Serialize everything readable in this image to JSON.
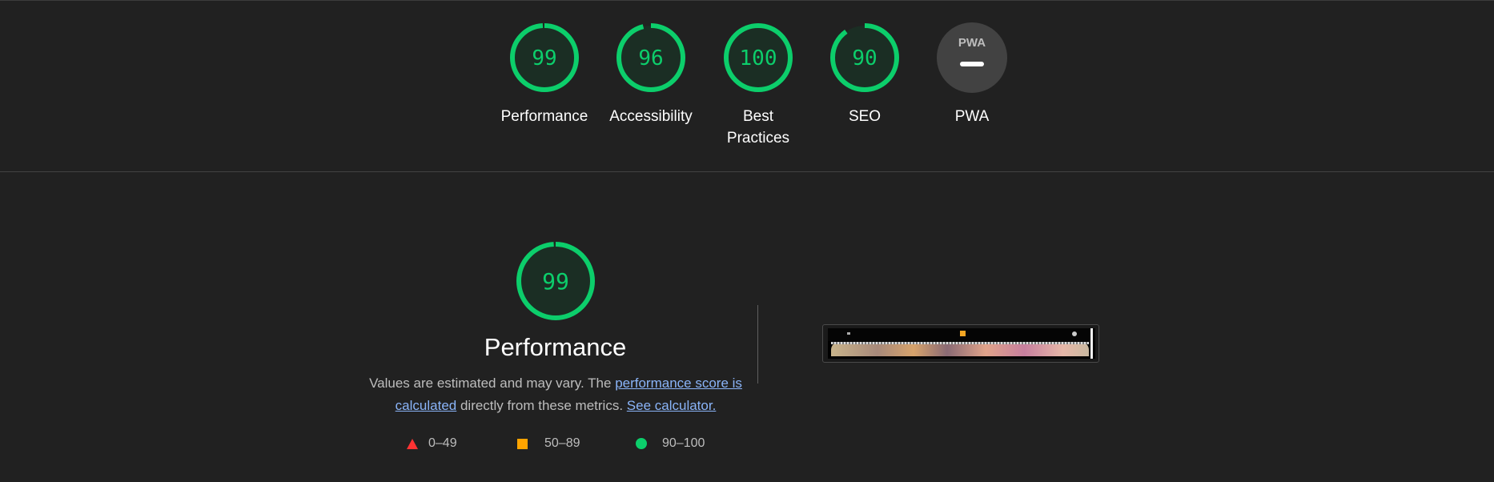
{
  "categories": [
    {
      "id": "performance",
      "label": "Performance",
      "score": "99",
      "value": 0.99
    },
    {
      "id": "accessibility",
      "label": "Accessibility",
      "score": "96",
      "value": 0.96
    },
    {
      "id": "best-practices",
      "label": "Best Practices",
      "score": "100",
      "value": 1.0
    },
    {
      "id": "seo",
      "label": "SEO",
      "score": "90",
      "value": 0.9
    },
    {
      "id": "pwa",
      "label": "PWA",
      "badge_text": "PWA"
    }
  ],
  "performance_section": {
    "score": "99",
    "value": 0.99,
    "title": "Performance",
    "desc_before": "Values are estimated and may vary. The ",
    "link_score": "performance score is calculated",
    "desc_middle": " directly from these metrics. ",
    "link_calculator": "See calculator."
  },
  "legend": [
    {
      "range": "0–49",
      "shape": "triangle",
      "color": "#ff3333"
    },
    {
      "range": "50–89",
      "shape": "square",
      "color": "#ffa400"
    },
    {
      "range": "90–100",
      "shape": "circle",
      "color": "#0cce6b"
    }
  ],
  "colors": {
    "pass": "#0cce6b",
    "gauge_fill": "#1b2e24",
    "background": "#212121",
    "link": "#8ab4f8"
  }
}
